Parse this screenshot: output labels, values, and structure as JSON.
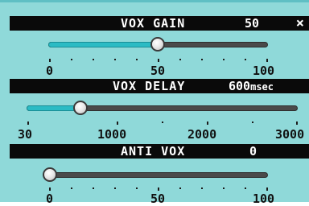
{
  "vox_gain": {
    "title": "VOX GAIN",
    "value": "50",
    "close_icon": "×",
    "level_fraction": 0.5,
    "scale_labels": [
      "0",
      "50",
      "100"
    ]
  },
  "vox_delay": {
    "title": "VOX DELAY",
    "value": "600",
    "unit": "msec",
    "level_value": 600,
    "scale_labels": [
      "30",
      "1000",
      "2000",
      "3000"
    ]
  },
  "anti_vox": {
    "title": "ANTI VOX",
    "value": "0",
    "level_fraction": 0.0,
    "scale_labels": [
      "0",
      "50",
      "100"
    ]
  },
  "colors": {
    "panel": "#8fd9d9",
    "header": "#0a0a0a",
    "fill": "#2bbbc4",
    "track": "#4a4a4a"
  }
}
